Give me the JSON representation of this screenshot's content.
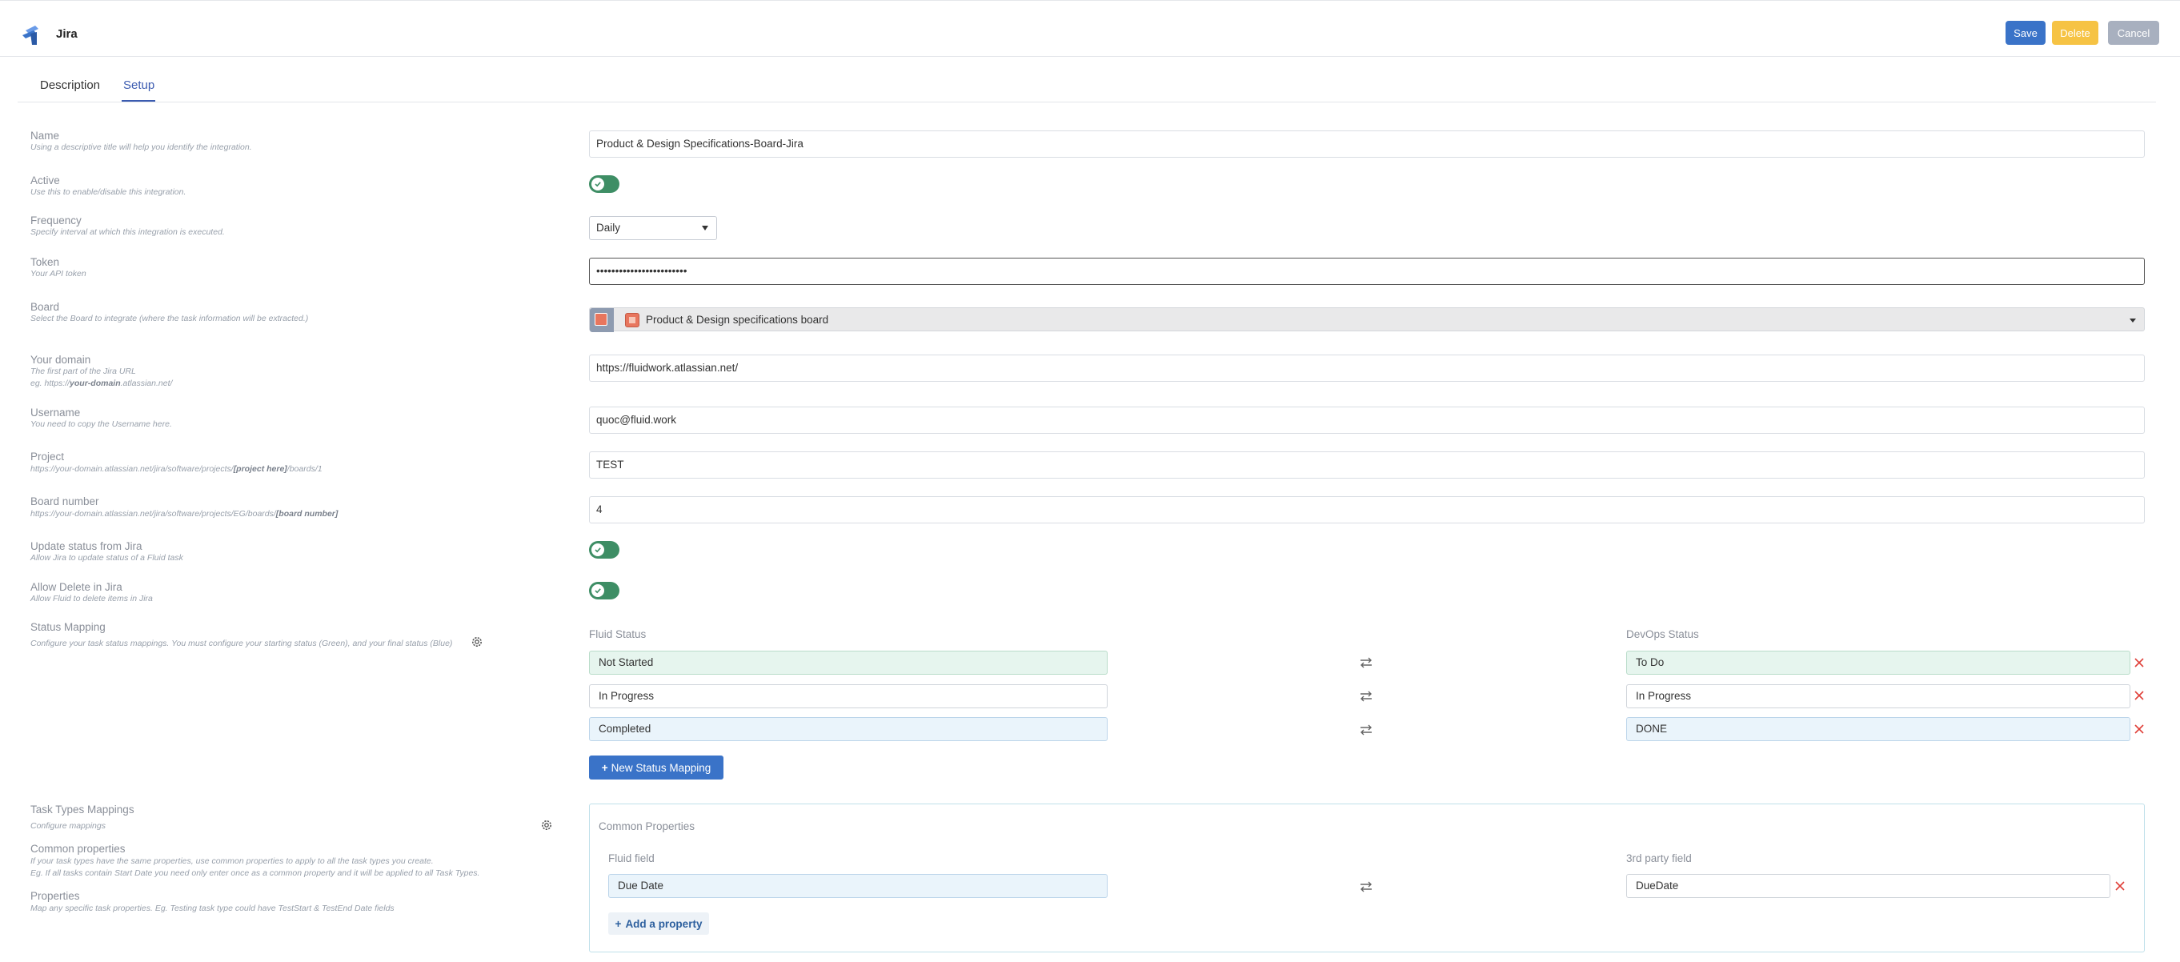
{
  "app": {
    "title": "Jira"
  },
  "header": {
    "save_label": "Save",
    "delete_label": "Delete",
    "cancel_label": "Cancel"
  },
  "tabs": [
    {
      "label": "Description"
    },
    {
      "label": "Setup",
      "active": true
    }
  ],
  "fields": {
    "name": {
      "label": "Name",
      "hint": "Using a descriptive title will help you identify the integration.",
      "value": "Product & Design Specifications-Board-Jira"
    },
    "active": {
      "label": "Active",
      "hint": "Use this to enable/disable this integration.",
      "enabled": true
    },
    "frequency": {
      "label": "Frequency",
      "hint": "Specify interval at which this integration is executed.",
      "value": "Daily"
    },
    "token": {
      "label": "Token",
      "hint": "Your API token",
      "value": "••••••••••••••••••••••••"
    },
    "board": {
      "label": "Board",
      "hint": "Select the Board to integrate (where the task information will be extracted.)",
      "value": "Product & Design specifications board"
    },
    "domain": {
      "label": "Your domain",
      "hint_line1": "The first part of the Jira URL",
      "hint_line2_prefix": "eg. https://",
      "hint_line2_bold": "your-domain",
      "hint_line2_suffix": ".atlassian.net/",
      "value": "https://fluidwork.atlassian.net/"
    },
    "username": {
      "label": "Username",
      "hint": "You need to copy the Username here.",
      "value": "quoc@fluid.work"
    },
    "project": {
      "label": "Project",
      "hint_prefix": "https://your-domain.atlassian.net/jira/software/projects/",
      "hint_bold": "[project here]",
      "hint_suffix": "/boards/1",
      "value": "TEST"
    },
    "board_number": {
      "label": "Board number",
      "hint_prefix": "https://your-domain.atlassian.net/jira/software/projects/EG/boards/",
      "hint_bold": "[board number]",
      "value": "4"
    },
    "update_status": {
      "label": "Update status from Jira",
      "hint": "Allow Jira to update status of a Fluid task",
      "enabled": true
    },
    "allow_delete": {
      "label": "Allow Delete in Jira",
      "hint": "Allow Fluid to delete items in Jira",
      "enabled": true
    }
  },
  "status_mapping": {
    "label": "Status Mapping",
    "hint": "Configure your task status mappings. You must configure your starting status (Green), and your final status (Blue)",
    "fluid_header": "Fluid Status",
    "devops_header": "DevOps Status",
    "rows": [
      {
        "fluid": "Not Started",
        "devops": "To Do",
        "color": "green"
      },
      {
        "fluid": "In Progress",
        "devops": "In Progress",
        "color": "none"
      },
      {
        "fluid": "Completed",
        "devops": "DONE",
        "color": "blue"
      }
    ],
    "new_button": "New Status Mapping"
  },
  "task_types": {
    "label": "Task Types Mappings",
    "hint": "Configure mappings",
    "common_label": "Common properties",
    "common_hint_1": "If your task types have the same properties, use common properties to apply to all the task types you create.",
    "common_hint_2": "Eg. If all tasks contain Start Date you need only enter once as a common property and it will be applied to all Task Types.",
    "properties_label": "Properties",
    "properties_hint": "Map any specific task properties. Eg. Testing task type could have TestStart & TestEnd Date fields",
    "box_title": "Common Properties",
    "fluid_field_header": "Fluid field",
    "third_party_header": "3rd party field",
    "rows": [
      {
        "fluid": "Due Date",
        "third_party": "DueDate"
      }
    ],
    "add_property": "Add a property"
  },
  "colors": {
    "primary": "#3a73c8",
    "warning": "#f6c344",
    "muted": "#a8b0bf",
    "toggle_on": "#3e8e65",
    "remove": "#e0413a"
  }
}
